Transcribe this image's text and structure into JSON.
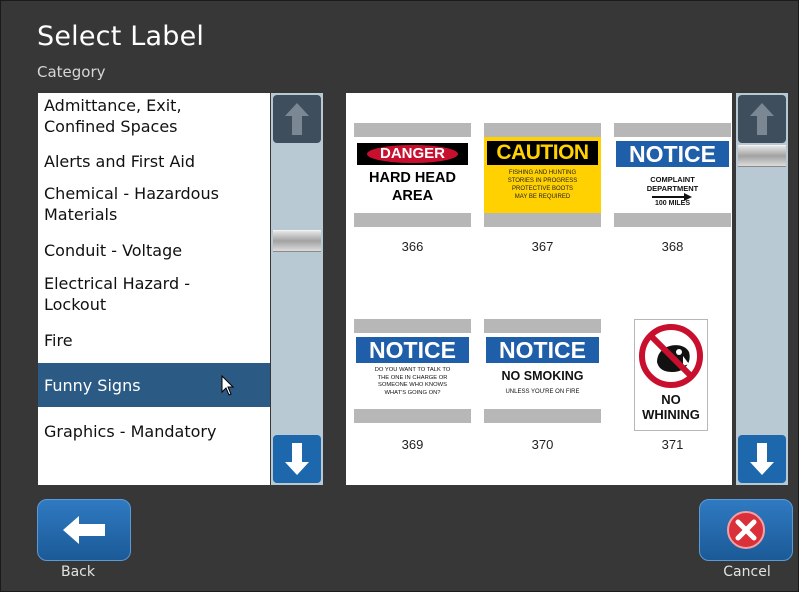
{
  "header": {
    "title": "Select Label",
    "category_label": "Category"
  },
  "categories": {
    "items": [
      {
        "label": "Admittance, Exit,\nConfined Spaces"
      },
      {
        "label": "Alerts and First Aid"
      },
      {
        "label": "Chemical - Hazardous\nMaterials"
      },
      {
        "label": "Conduit - Voltage"
      },
      {
        "label": "Electrical Hazard -\nLockout"
      },
      {
        "label": "Fire"
      },
      {
        "label": "Funny Signs",
        "selected": true
      },
      {
        "label": "Graphics - Mandatory"
      }
    ],
    "scroll_position": 0.35
  },
  "labels": {
    "scroll_position": 0.12,
    "tiles": [
      {
        "number": "366",
        "type": "danger",
        "header": "DANGER",
        "body": "HARD HEAD\nAREA"
      },
      {
        "number": "367",
        "type": "caution",
        "header": "CAUTION",
        "body": "FISHING AND HUNTING\nSTORIES IN PROGRESS\nPROTECTIVE BOOTS\nMAY BE REQUIRED"
      },
      {
        "number": "368",
        "type": "notice",
        "header": "NOTICE",
        "body": "COMPLAINT\nDEPARTMENT",
        "footer": "100 MILES"
      },
      {
        "number": "369",
        "type": "notice",
        "header": "NOTICE",
        "body": "DO YOU WANT TO TALK TO\nTHE ONE IN CHARGE OR\nSOMEONE WHO KNOWS\nWHAT'S GOING ON?"
      },
      {
        "number": "370",
        "type": "notice",
        "header": "NOTICE",
        "body": "NO SMOKING",
        "footer": "UNLESS YOU'RE ON FIRE"
      },
      {
        "number": "371",
        "type": "graphic",
        "body": "NO\nWHINING"
      }
    ]
  },
  "footer": {
    "back_label": "Back",
    "cancel_label": "Cancel"
  },
  "colors": {
    "background": "#373737",
    "selection": "#2b5a84",
    "button": "#1d67ad",
    "danger_red": "#c8102e",
    "caution_yellow": "#ffd100",
    "notice_blue": "#1f5ea8",
    "cancel_red": "#d9303a"
  }
}
